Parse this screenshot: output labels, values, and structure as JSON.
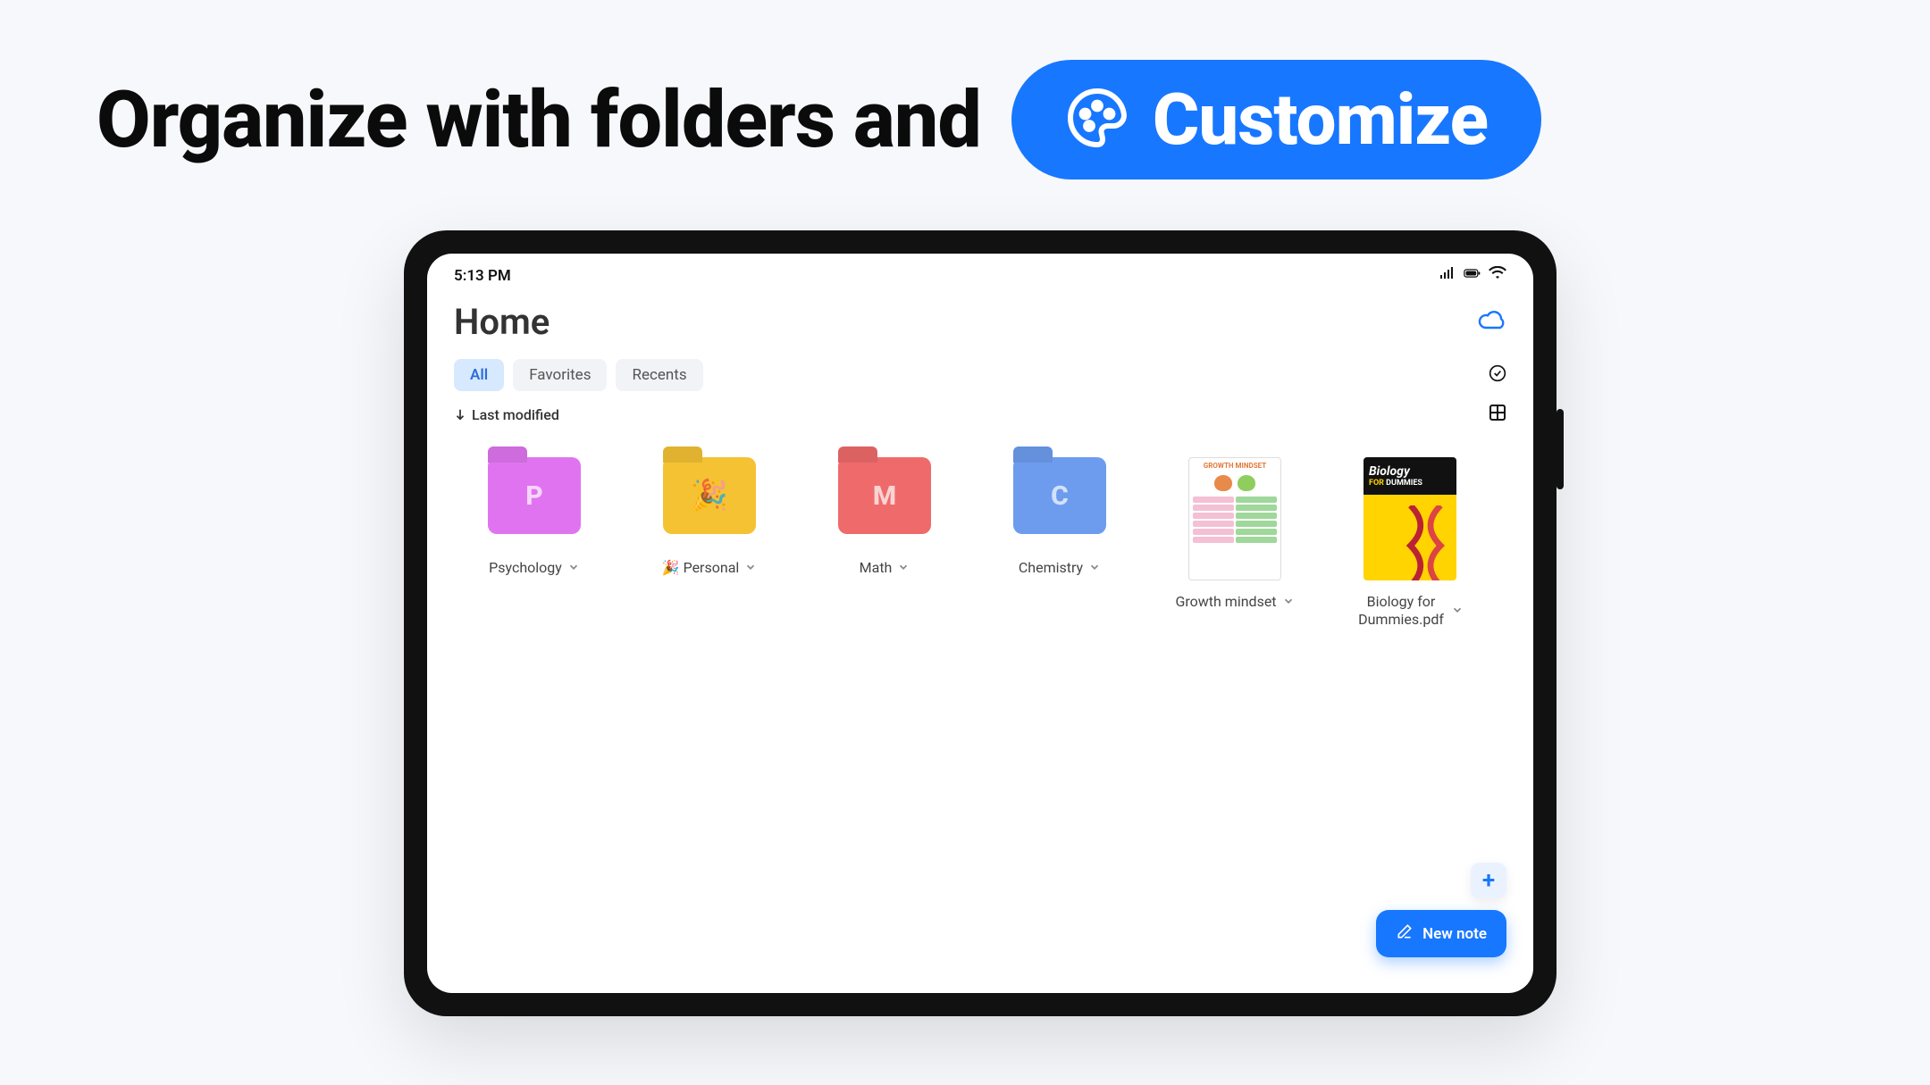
{
  "headline": {
    "text": "Organize with folders and",
    "pill_label": "Customize"
  },
  "status": {
    "time": "5:13 PM"
  },
  "page": {
    "title": "Home"
  },
  "tabs": {
    "all": "All",
    "favorites": "Favorites",
    "recents": "Recents"
  },
  "sort": {
    "label": "Last modified"
  },
  "items": [
    {
      "label": "Psychology"
    },
    {
      "label": "🎉 Personal"
    },
    {
      "label": "Math"
    },
    {
      "label": "Chemistry"
    },
    {
      "label": "Growth mindset",
      "thumb_title": "GROWTH MINDSET"
    },
    {
      "label": "Biology for Dummies.pdf",
      "book_title": "Biology",
      "book_for": "FOR",
      "book_sub": "DUMMIES"
    }
  ],
  "fab": {
    "new_note": "New note"
  }
}
